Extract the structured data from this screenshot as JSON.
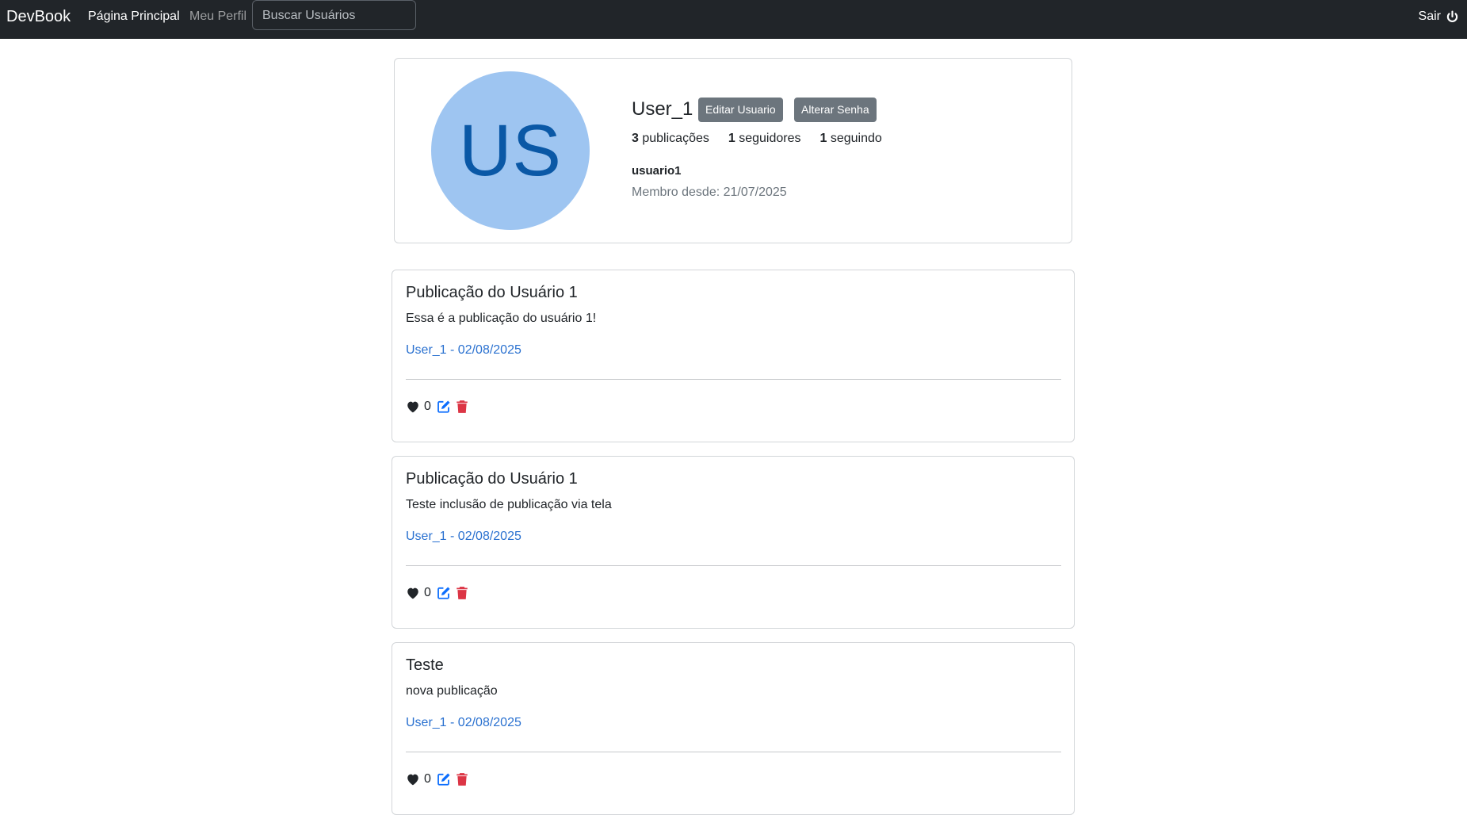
{
  "navbar": {
    "brand": "DevBook",
    "home": "Página Principal",
    "profile": "Meu Perfil",
    "search_placeholder": "Buscar Usuários",
    "logout": "Sair"
  },
  "profile": {
    "avatar_initials": "US",
    "name": "User_1",
    "edit_button": "Editar Usuario",
    "password_button": "Alterar Senha",
    "stats": {
      "publications_count": "3",
      "publications_label": "publicações",
      "followers_count": "1",
      "followers_label": "seguidores",
      "following_count": "1",
      "following_label": "seguindo"
    },
    "nick": "usuario1",
    "member_since": "Membro desde: 21/07/2025"
  },
  "posts": [
    {
      "title": "Publicação do Usuário 1",
      "body": "Essa é a publicação do usuário 1!",
      "meta": "User_1 - 02/08/2025",
      "likes": "0"
    },
    {
      "title": "Publicação do Usuário 1",
      "body": "Teste inclusão de publicação via tela",
      "meta": "User_1 - 02/08/2025",
      "likes": "0"
    },
    {
      "title": "Teste",
      "body": "nova publicação",
      "meta": "User_1 - 02/08/2025",
      "likes": "0"
    }
  ],
  "icons": {
    "like": "heart-icon",
    "edit": "edit-icon",
    "delete": "trash-icon",
    "logout": "power-icon"
  },
  "colors": {
    "navbar": "#212529",
    "avatar_bg": "#9ec5f1",
    "avatar_text": "#0a58a6",
    "secondary_button": "#6c757d",
    "link": "#2a71d0",
    "edit_icon": "#0d6efd",
    "delete_icon": "#dc3545"
  }
}
